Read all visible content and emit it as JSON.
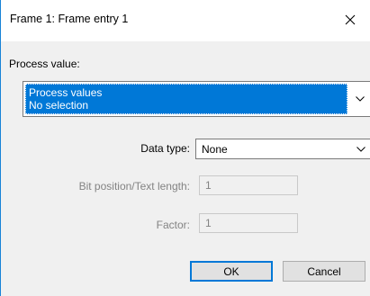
{
  "window": {
    "title": "Frame 1: Frame entry 1"
  },
  "process_value": {
    "label": "Process value:",
    "selected_lines": [
      "Process values",
      "No selection"
    ]
  },
  "data_type": {
    "label": "Data type:",
    "value": "None"
  },
  "bit_position": {
    "label": "Bit position/Text length:",
    "value": "1"
  },
  "factor": {
    "label": "Factor:",
    "value": "1"
  },
  "buttons": {
    "ok": "OK",
    "cancel": "Cancel"
  },
  "colors": {
    "accent": "#0078d7",
    "border_accent": "#1883d7",
    "disabled_text": "#838383"
  },
  "icons": {
    "close": "close-icon",
    "dropdown": "chevron-down-icon"
  }
}
